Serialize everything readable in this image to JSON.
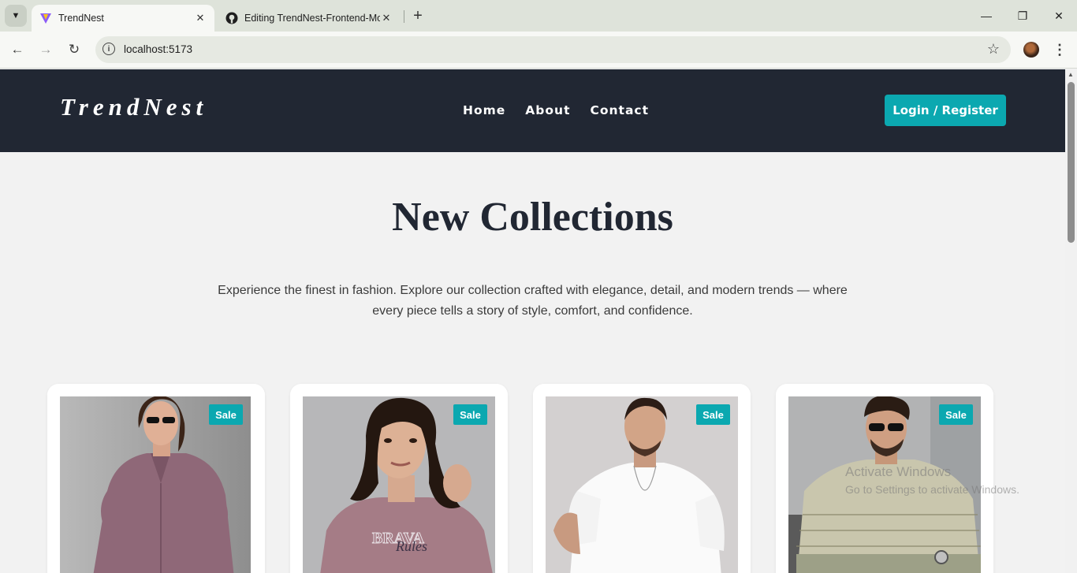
{
  "browser": {
    "tabs": [
      {
        "title": "TrendNest",
        "active": true,
        "icon": "vite-icon"
      },
      {
        "title": "Editing TrendNest-Frontend-Mo",
        "active": false,
        "icon": "github-icon"
      }
    ],
    "address": "localhost:5173"
  },
  "header": {
    "logo": "TrendNest",
    "nav": [
      "Home",
      "About",
      "Contact"
    ],
    "login_label": "Login / Register",
    "background": "#212733",
    "accent": "#0ba8b0"
  },
  "hero": {
    "title": "New Collections",
    "subtitle_line1": "Experience the finest in fashion. Explore our collection crafted with elegance, detail, and modern trends — where",
    "subtitle_line2": "every piece tells a story of style, comfort, and confidence."
  },
  "products": [
    {
      "badge": "Sale",
      "image": "woman-mauve-shirt-sunglasses"
    },
    {
      "badge": "Sale",
      "image": "woman-mauve-graphic-tee"
    },
    {
      "badge": "Sale",
      "image": "man-white-tshirt"
    },
    {
      "badge": "Sale",
      "image": "man-beige-striped-tee-sunglasses"
    }
  ],
  "watermark": {
    "line1": "Activate Windows",
    "line2": "Go to Settings to activate Windows."
  }
}
